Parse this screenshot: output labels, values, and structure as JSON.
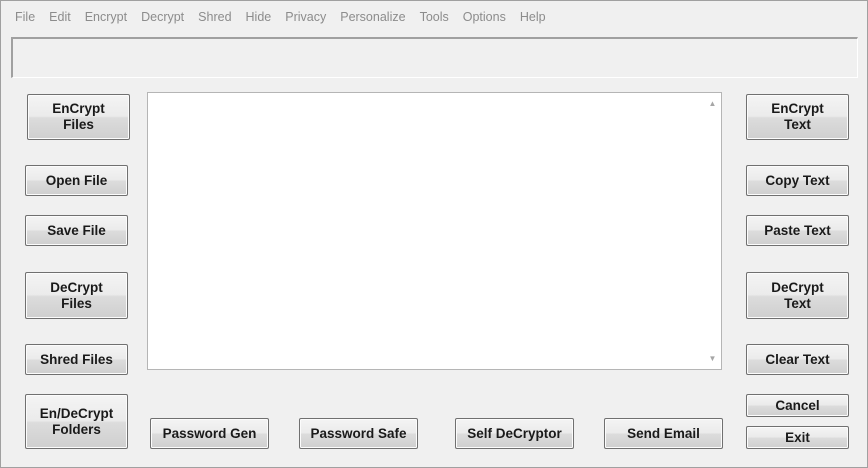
{
  "menu": [
    "File",
    "Edit",
    "Encrypt",
    "Decrypt",
    "Shred",
    "Hide",
    "Privacy",
    "Personalize",
    "Tools",
    "Options",
    "Help"
  ],
  "status_text": "",
  "main_text": "",
  "left_buttons": {
    "encrypt_files": "EnCrypt\nFiles",
    "open_file": "Open File",
    "save_file": "Save File",
    "decrypt_files": "DeCrypt\nFiles",
    "shred_files": "Shred Files",
    "endecrypt_folders": "En/DeCrypt\nFolders"
  },
  "right_buttons": {
    "encrypt_text": "EnCrypt\nText",
    "copy_text": "Copy Text",
    "paste_text": "Paste Text",
    "decrypt_text": "DeCrypt\nText",
    "clear_text": "Clear Text",
    "cancel": "Cancel",
    "exit": "Exit"
  },
  "bottom_buttons": {
    "password_gen": "Password Gen",
    "password_safe": "Password Safe",
    "self_decryptor": "Self DeCryptor",
    "send_email": "Send Email"
  },
  "icons": {
    "scroll_up": "scroll-up-arrow",
    "scroll_down": "scroll-down-arrow"
  }
}
